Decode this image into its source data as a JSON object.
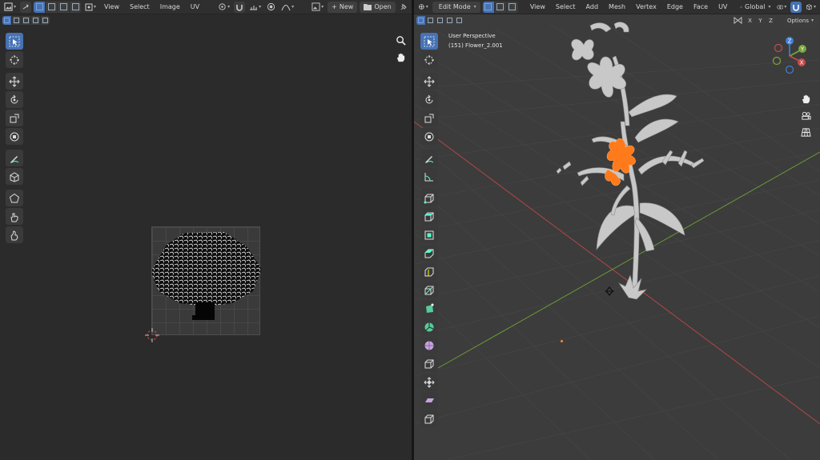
{
  "uv_editor": {
    "menus": [
      "View",
      "Select",
      "Image",
      "UV"
    ],
    "new_label": "New",
    "open_label": "Open"
  },
  "viewport": {
    "mode_label": "Edit Mode",
    "menus": [
      "View",
      "Select",
      "Add",
      "Mesh",
      "Vertex",
      "Edge",
      "Face",
      "UV"
    ],
    "orientation_label": "Global",
    "axis_x": "X",
    "axis_y": "Y",
    "axis_z": "Z",
    "options_label": "Options",
    "overlay_perspective": "User Perspective",
    "overlay_object": "(151) Flower_2.001",
    "gizmo_labels": {
      "x": "X",
      "y": "Y",
      "z": "Z"
    }
  },
  "colors": {
    "accent": "#4772b3",
    "selection": "#ff7a1a",
    "x_axis": "#c94b4b",
    "y_axis": "#7aa83a",
    "z_axis": "#3f7fd9"
  }
}
